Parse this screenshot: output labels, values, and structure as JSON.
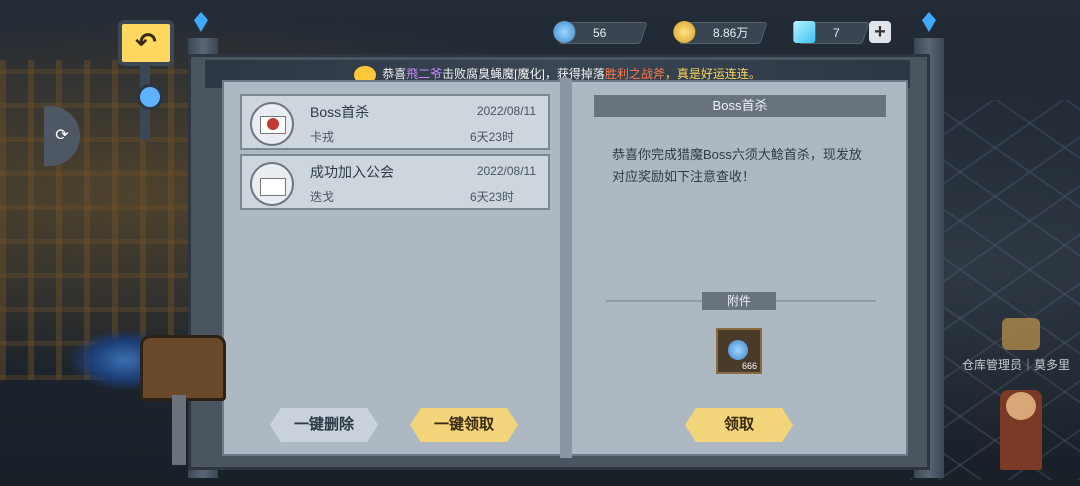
{
  "currency": {
    "orb": {
      "value": "56",
      "icon": "blue-orb-icon"
    },
    "gold": {
      "value": "8.86万",
      "icon": "gold-coin-icon"
    },
    "diamond": {
      "value": "7",
      "icon": "diamond-icon"
    },
    "add_label": "+"
  },
  "banner": {
    "p1": "恭喜",
    "player": "飛二爷",
    "p2": "击败腐臭蝇魔[魔化]，获得掉落",
    "item": "胜利之战斧",
    "p3": "，真是好运连连。"
  },
  "mails": [
    {
      "title": "Boss首杀",
      "date": "2022/08/11",
      "sender": "卡戎",
      "remaining": "6天23时",
      "icon": "sealed-mail-icon"
    },
    {
      "title": "成功加入公会",
      "date": "2022/08/11",
      "sender": "迭戈",
      "remaining": "6天23时",
      "icon": "open-mail-icon"
    }
  ],
  "buttons": {
    "delete_all": "一键删除",
    "claim_all": "一键领取",
    "claim": "领取"
  },
  "detail": {
    "title": "Boss首杀",
    "body": "恭喜你完成猎魔Boss六须大鲶首杀，现发放对应奖励如下注意查收！",
    "attachment_label": "附件",
    "attachment": {
      "icon": "blue-orb-icon",
      "count": "666"
    }
  },
  "side_button": "⟳",
  "npc_label": "仓库管理员｜莫多里",
  "colors": {
    "gold_button": "#f2d57b",
    "grey_button": "#c9d2da",
    "banner_highlight": "#ffd659"
  }
}
